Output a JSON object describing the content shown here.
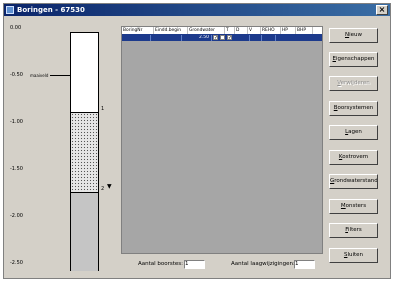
{
  "window": {
    "title": "Boringen - 67530",
    "close_glyph": "×"
  },
  "profile": {
    "depth_ticks": [
      "0.00",
      "-0.50",
      "-1.00",
      "-1.50",
      "-2.00",
      "-2.50"
    ],
    "surface_label": "maaiveld",
    "layer_marker_1": "1",
    "layer_marker_2": "2",
    "water_mark": "▼"
  },
  "table": {
    "headers": [
      "BoringNr",
      "Eindd.begin",
      "Grondwater",
      "T",
      "D",
      "V",
      "REHO",
      "HP",
      "BHP"
    ],
    "row": {
      "value": "2.50",
      "t_checked": "✓",
      "d_checked": "",
      "v_checked": "✓"
    }
  },
  "bottom": {
    "count_label": "Aantal boorstes:",
    "count_value": "1",
    "changes_label": "Aantal laagwijzigingen:",
    "changes_value": "1"
  },
  "buttons": [
    {
      "label": "Nieuw",
      "underline": "N",
      "enabled": true
    },
    {
      "label": "Eigenschappen",
      "underline": "E",
      "enabled": true
    },
    {
      "label": "Verwijderen",
      "underline": "V",
      "enabled": false
    },
    {
      "label": "Boorsystemen",
      "underline": "B",
      "enabled": true
    },
    {
      "label": "Lagen",
      "underline": "L",
      "enabled": true
    },
    {
      "label": "Kostrovem",
      "underline": "K",
      "enabled": true
    },
    {
      "label": "Grondwaterstand",
      "underline": "G",
      "enabled": true
    },
    {
      "label": "Monsters",
      "underline": "M",
      "enabled": true
    },
    {
      "label": "Filters",
      "underline": "F",
      "enabled": true
    },
    {
      "label": "Sluiten",
      "underline": "S",
      "enabled": true
    }
  ]
}
